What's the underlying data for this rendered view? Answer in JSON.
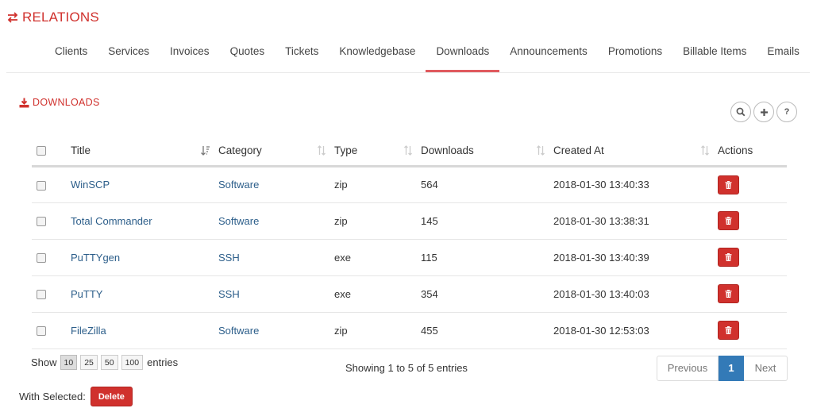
{
  "header": {
    "title": "RELATIONS",
    "icon": "exchange-icon",
    "color": "#d0312d"
  },
  "tabs": [
    {
      "label": "Clients"
    },
    {
      "label": "Services"
    },
    {
      "label": "Invoices"
    },
    {
      "label": "Quotes"
    },
    {
      "label": "Tickets"
    },
    {
      "label": "Knowledgebase"
    },
    {
      "label": "Downloads",
      "active": true
    },
    {
      "label": "Announcements"
    },
    {
      "label": "Promotions"
    },
    {
      "label": "Billable Items"
    },
    {
      "label": "Emails"
    }
  ],
  "section": {
    "title": "DOWNLOADS",
    "icon": "download-icon"
  },
  "tools": [
    {
      "icon": "search-icon"
    },
    {
      "icon": "plus-icon"
    },
    {
      "icon": "help-icon",
      "glyph": "?"
    }
  ],
  "table": {
    "columns": [
      "Title",
      "Category",
      "Type",
      "Downloads",
      "Created At",
      "Actions"
    ],
    "rows": [
      {
        "title": "WinSCP",
        "category": "Software",
        "type": "zip",
        "downloads": "564",
        "created_at": "2018-01-30 13:40:33"
      },
      {
        "title": "Total Commander",
        "category": "Software",
        "type": "zip",
        "downloads": "145",
        "created_at": "2018-01-30 13:38:31"
      },
      {
        "title": "PuTTYgen",
        "category": "SSH",
        "type": "exe",
        "downloads": "115",
        "created_at": "2018-01-30 13:40:39"
      },
      {
        "title": "PuTTY",
        "category": "SSH",
        "type": "exe",
        "downloads": "354",
        "created_at": "2018-01-30 13:40:03"
      },
      {
        "title": "FileZilla",
        "category": "Software",
        "type": "zip",
        "downloads": "455",
        "created_at": "2018-01-30 12:53:03"
      }
    ]
  },
  "length": {
    "show_label": "Show",
    "options": [
      "10",
      "25",
      "50",
      "100"
    ],
    "selected": "10",
    "entries_label": "entries"
  },
  "info": "Showing 1 to 5 of 5 entries",
  "pagination": {
    "previous": "Previous",
    "current": "1",
    "next": "Next"
  },
  "bulk": {
    "label": "With Selected:",
    "delete": "Delete"
  },
  "colors": {
    "accent": "#d0312d",
    "link": "#2c5e8a",
    "tab_underline": "#e05a5f",
    "page_active": "#337ab7"
  }
}
